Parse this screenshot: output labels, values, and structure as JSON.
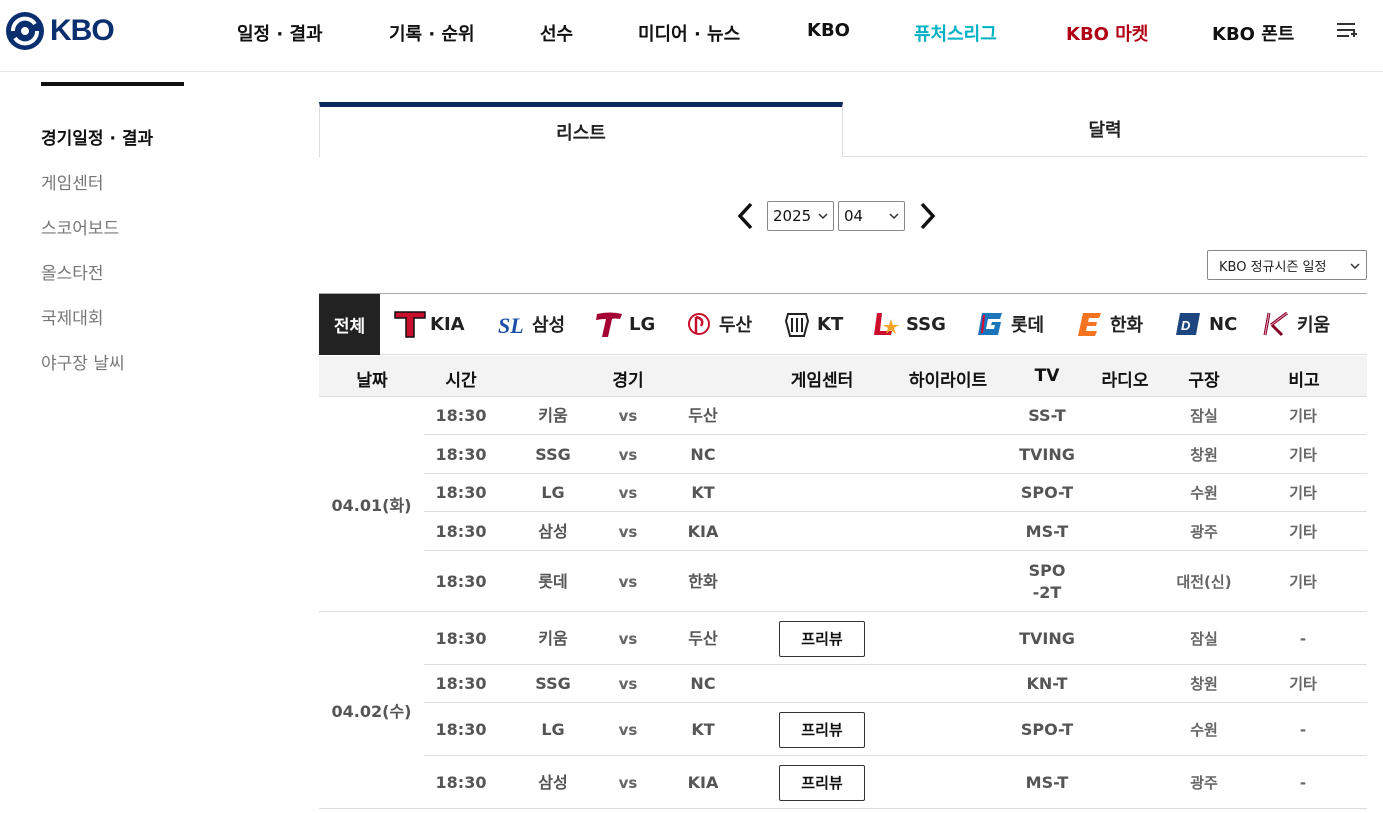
{
  "header": {
    "logo_text": "KBO",
    "nav": [
      "일정 · 결과",
      "기록 · 순위",
      "선수",
      "미디어 · 뉴스",
      "KBO",
      "퓨처스리그",
      "KBO 마켓",
      "KBO 폰트"
    ],
    "futures_color": "#00b2c3",
    "market_color": "#b10015"
  },
  "sidebar": {
    "items": [
      "경기일정 · 결과",
      "게임센터",
      "스코어보드",
      "올스타전",
      "국제대회",
      "야구장 날씨"
    ]
  },
  "tabs": {
    "list": "리스트",
    "calendar": "달력"
  },
  "filters": {
    "year": "2025",
    "month": "04",
    "season": "KBO 정규시즌 일정"
  },
  "teams": [
    "전체",
    "KIA",
    "삼성",
    "LG",
    "두산",
    "KT",
    "SSG",
    "롯데",
    "한화",
    "NC",
    "키움"
  ],
  "table": {
    "headers": [
      "날짜",
      "시간",
      "경기",
      "게임센터",
      "하이라이트",
      "TV",
      "라디오",
      "구장",
      "비고"
    ],
    "vs_label": "vs",
    "preview_label": "프리뷰",
    "days": [
      {
        "date": "04.01(화)",
        "games": [
          {
            "time": "18:30",
            "away": "키움",
            "home": "두산",
            "tv": "SS-T",
            "stadium": "잠실",
            "note": "기타"
          },
          {
            "time": "18:30",
            "away": "SSG",
            "home": "NC",
            "tv": "TVING",
            "stadium": "창원",
            "note": "기타"
          },
          {
            "time": "18:30",
            "away": "LG",
            "home": "KT",
            "tv": "SPO-T",
            "stadium": "수원",
            "note": "기타"
          },
          {
            "time": "18:30",
            "away": "삼성",
            "home": "KIA",
            "tv": "MS-T",
            "stadium": "광주",
            "note": "기타"
          },
          {
            "time": "18:30",
            "away": "롯데",
            "home": "한화",
            "tv": "SPO-2T",
            "stadium": "대전(신)",
            "note": "기타"
          }
        ]
      },
      {
        "date": "04.02(수)",
        "games": [
          {
            "time": "18:30",
            "away": "키움",
            "home": "두산",
            "tv": "TVING",
            "stadium": "잠실",
            "note": "-"
          },
          {
            "time": "18:30",
            "away": "SSG",
            "home": "NC",
            "tv": "KN-T",
            "stadium": "창원",
            "note": "기타"
          },
          {
            "time": "18:30",
            "away": "LG",
            "home": "KT",
            "tv": "SPO-T",
            "stadium": "수원",
            "note": "-"
          },
          {
            "time": "18:30",
            "away": "삼성",
            "home": "KIA",
            "tv": "MS-T",
            "stadium": "광주",
            "note": "-"
          }
        ]
      }
    ]
  }
}
